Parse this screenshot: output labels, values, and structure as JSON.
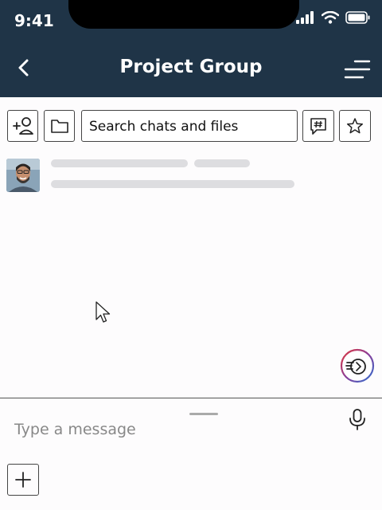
{
  "status_bar": {
    "time": "9:41"
  },
  "header": {
    "title": "Project Group"
  },
  "toolbar": {
    "search_placeholder": "Search chats and files"
  },
  "composer": {
    "placeholder": "Type a message"
  },
  "icons": {
    "back": "back-icon",
    "menu": "menu-icon",
    "add_member": "add-person-icon",
    "folder": "folder-icon",
    "channel": "hashtag-chat-icon",
    "star": "star-icon",
    "fab": "express-icon",
    "mic": "microphone-icon",
    "plus": "plus-icon"
  },
  "colors": {
    "header_bg": "#1f3447",
    "skeleton": "#dddde0"
  }
}
